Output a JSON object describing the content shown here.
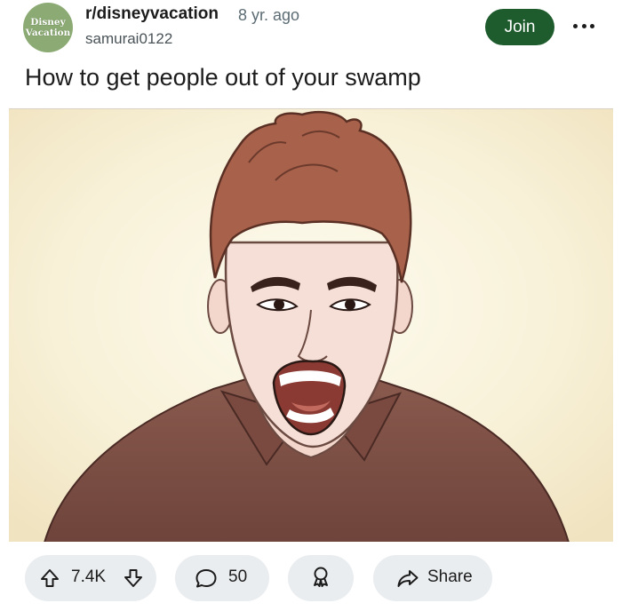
{
  "post": {
    "subreddit_avatar_line1": "Disney",
    "subreddit_avatar_line2": "Vacation",
    "subreddit": "r/disneyvacation",
    "age": "8 yr. ago",
    "author": "samurai0122",
    "join_label": "Join",
    "title": "How to get people out of your swamp"
  },
  "actions": {
    "upvotes": "7.4K",
    "comments": "50",
    "share_label": "Share"
  },
  "colors": {
    "join_bg": "#1e5c2e",
    "avatar_bg": "#8cab74",
    "pill_bg": "#eaedef"
  },
  "icons": [
    "overflow-menu-icon",
    "upvote-icon",
    "downvote-icon",
    "comment-icon",
    "award-icon",
    "share-icon"
  ]
}
